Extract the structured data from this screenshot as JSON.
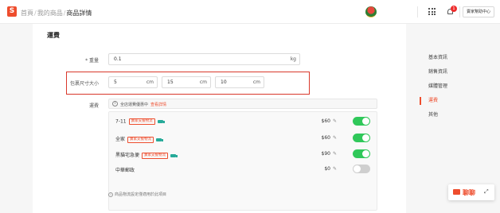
{
  "header": {
    "logo_letter": "S",
    "breadcrumb": [
      "首頁",
      "我的商品",
      "商品詳情"
    ],
    "help_button": "賣家幫助中心",
    "notification_count": "1"
  },
  "section": {
    "title": "運費"
  },
  "weight": {
    "label": "* 重量",
    "value": "0.1",
    "unit": "kg"
  },
  "package": {
    "label": "包裹尺寸大小",
    "dims": [
      {
        "value": "5",
        "unit": "cm"
      },
      {
        "value": "15",
        "unit": "cm"
      },
      {
        "value": "10",
        "unit": "cm"
      }
    ]
  },
  "shipping": {
    "label": "運費",
    "info_text": "全店運費優惠中",
    "info_link": "查看詳情",
    "channels": [
      {
        "name": "7-11",
        "tag": "賣家支援物流",
        "truck": true,
        "price": "$60",
        "enabled": true
      },
      {
        "name": "全家",
        "tag": "賣家支援物流",
        "truck": true,
        "price": "$60",
        "enabled": true
      },
      {
        "name": "黑貓宅急便",
        "tag": "賣家支援物流",
        "truck": true,
        "price": "$90",
        "enabled": true
      },
      {
        "name": "中華郵政",
        "tag": "",
        "truck": false,
        "price": "$0",
        "enabled": false
      }
    ],
    "note": "商品物流設定僅適用於此項目"
  },
  "sidenav": [
    {
      "label": "基本資訊",
      "active": false
    },
    {
      "label": "銷售資訊",
      "active": false
    },
    {
      "label": "媒體管理",
      "active": false
    },
    {
      "label": "運費",
      "active": true
    },
    {
      "label": "其他",
      "active": false
    }
  ],
  "chat": {
    "label": "聊聊"
  },
  "colors": {
    "accent": "#ee4d2d",
    "toggle_on": "#30c85a",
    "highlight_border": "#d9382b"
  }
}
